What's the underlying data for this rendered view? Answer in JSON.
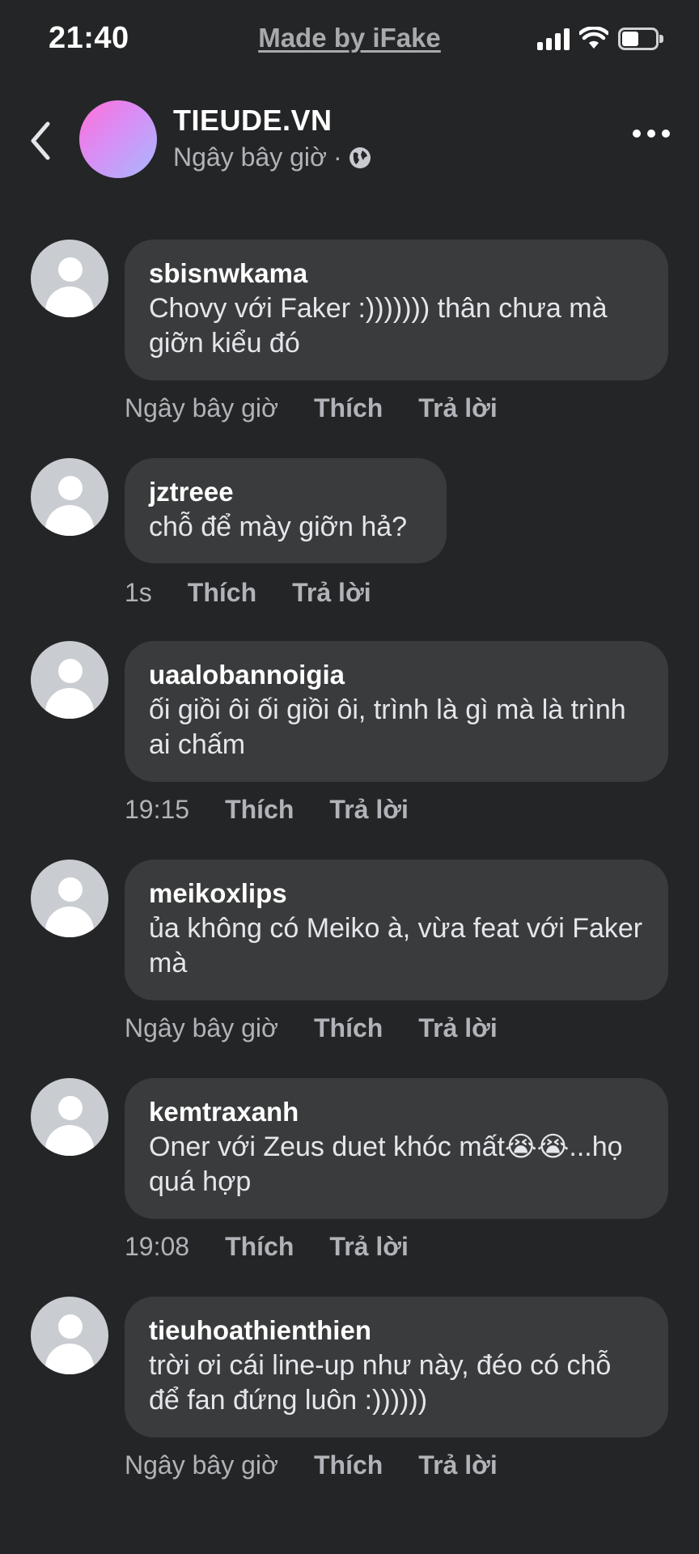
{
  "status_bar": {
    "time": "21:40",
    "center_label": "Made by iFake"
  },
  "header": {
    "page_name": "TIEUDE.VN",
    "meta_time": "Ngây bây giờ",
    "meta_sep": "·"
  },
  "actions": {
    "like": "Thích",
    "reply": "Trả lời"
  },
  "comments": [
    {
      "author": "sbisnwkama",
      "text": "Chovy với Faker :))))))) thân chưa mà giỡn kiểu đó",
      "time": "Ngây bây giờ"
    },
    {
      "author": "jztreee",
      "text": "chỗ để mày giỡn hả?",
      "time": "1s"
    },
    {
      "author": "uaalobannoigia",
      "text": "ối giồi ôi ối giồi ôi, trình là gì mà là trình ai chấm",
      "time": "19:15"
    },
    {
      "author": "meikoxlips",
      "text": "ủa không có Meiko à, vừa feat với Faker mà",
      "time": "Ngây bây giờ"
    },
    {
      "author": "kemtraxanh",
      "text": "Oner với Zeus duet khóc mất😭😭...họ quá hợp",
      "time": "19:08"
    },
    {
      "author": "tieuhoathienthien",
      "text": "trời ơi cái line-up như này, đéo có chỗ để fan đứng luôn :))))))",
      "time": "Ngây bây giờ"
    }
  ]
}
